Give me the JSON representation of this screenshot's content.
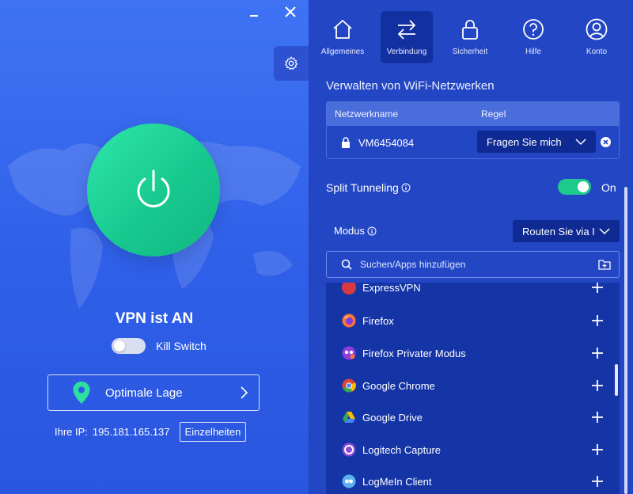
{
  "window": {
    "minimize_icon": "minimize-icon",
    "close_icon": "close-icon",
    "settings_icon": "gear-icon"
  },
  "left": {
    "status": "VPN ist AN",
    "kill_switch": {
      "label": "Kill Switch",
      "enabled": false
    },
    "location": {
      "label": "Optimale Lage",
      "icon": "map-pin-icon"
    },
    "ip": {
      "label": "Ihre IP:",
      "value": "195.181.165.137",
      "details_button": "Einzelheiten"
    },
    "colors": {
      "power_green": "#1fd59a",
      "background": "#3565ee"
    }
  },
  "tabs": [
    {
      "label": "Allgemeines",
      "icon": "home-icon",
      "active": false
    },
    {
      "label": "Verbindung",
      "icon": "arrows-exchange-icon",
      "active": true
    },
    {
      "label": "Sicherheit",
      "icon": "lock-icon",
      "active": false
    },
    {
      "label": "Hilfe",
      "icon": "help-icon",
      "active": false
    },
    {
      "label": "Konto",
      "icon": "user-icon",
      "active": false
    }
  ],
  "wifi": {
    "title": "Verwalten von WiFi-Netzwerken",
    "columns": [
      "Netzwerkname",
      "Regel"
    ],
    "networks": [
      {
        "name": "VM6454084",
        "rule": "Fragen Sie mich"
      }
    ]
  },
  "split_tunneling": {
    "label": "Split Tunneling",
    "state": "On",
    "enabled": true
  },
  "mode": {
    "label": "Modus",
    "value": "Routen Sie via I"
  },
  "search": {
    "placeholder": "Suchen/Apps hinzufügen"
  },
  "apps": [
    {
      "name": "ExpressVPN",
      "icon": "expressvpn-icon",
      "color": "#da3940"
    },
    {
      "name": "Firefox",
      "icon": "firefox-icon",
      "color": "#ff7139"
    },
    {
      "name": "Firefox Privater Modus",
      "icon": "firefox-private-icon",
      "color": "#8f3be0"
    },
    {
      "name": "Google Chrome",
      "icon": "chrome-icon",
      "color": "#34a853"
    },
    {
      "name": "Google Drive",
      "icon": "google-drive-icon",
      "color": "#fbbc04"
    },
    {
      "name": "Logitech Capture",
      "icon": "logitech-capture-icon",
      "color": "#8a4bd8"
    },
    {
      "name": "LogMeIn Client",
      "icon": "logmein-icon",
      "color": "#5ab0f0"
    }
  ]
}
